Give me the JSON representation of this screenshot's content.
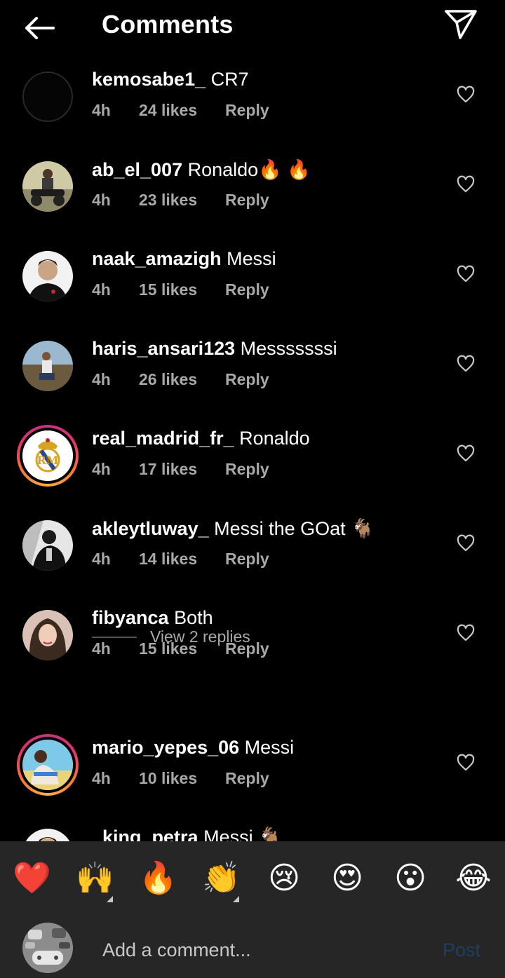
{
  "header": {
    "title": "Comments",
    "back_icon": "arrow-left-icon",
    "send_icon": "paper-plane-icon"
  },
  "comments": [
    {
      "user": "kemosabe1_",
      "text": "CR7",
      "time": "4h",
      "likes": "24 likes",
      "reply": "Reply",
      "avatar_style": "plain",
      "story_ring": false
    },
    {
      "user": "ab_el_007",
      "text": "Ronaldo🔥 🔥",
      "time": "4h",
      "likes": "23 likes",
      "reply": "Reply",
      "avatar_style": "motorbike",
      "story_ring": false
    },
    {
      "user": "naak_amazigh",
      "text": "Messi",
      "time": "4h",
      "likes": "15 likes",
      "reply": "Reply",
      "avatar_style": "portrait",
      "story_ring": false
    },
    {
      "user": "haris_ansari123",
      "text": "Messsssssi",
      "time": "4h",
      "likes": "26 likes",
      "reply": "Reply",
      "avatar_style": "outdoor",
      "story_ring": false
    },
    {
      "user": "real_madrid_fr_",
      "text": "Ronaldo",
      "time": "4h",
      "likes": "17 likes",
      "reply": "Reply",
      "avatar_style": "crest",
      "story_ring": true
    },
    {
      "user": "akleytluway_",
      "text": "Messi the GOat 🐐",
      "time": "4h",
      "likes": "14 likes",
      "reply": "Reply",
      "avatar_style": "bw",
      "story_ring": false
    },
    {
      "user": "fibyanca",
      "text": "Both",
      "time": "4h",
      "likes": "15 likes",
      "reply": "Reply",
      "avatar_style": "woman",
      "story_ring": false
    },
    {
      "user": "mario_yepes_06",
      "text": "Messi",
      "time": "4h",
      "likes": "10 likes",
      "reply": "Reply",
      "avatar_style": "beach",
      "story_ring": true
    },
    {
      "user": "_king_petra",
      "text": "Messi 🐐",
      "time": "",
      "likes": "",
      "reply": "",
      "avatar_style": "portrait",
      "story_ring": false
    }
  ],
  "view_replies": "View 2 replies",
  "reactions": [
    {
      "emoji": "❤️",
      "name": "red-heart-emoji",
      "has_variants": false
    },
    {
      "emoji": "🙌",
      "name": "raising-hands-emoji",
      "has_variants": true
    },
    {
      "emoji": "🔥",
      "name": "fire-emoji",
      "has_variants": false
    },
    {
      "emoji": "👏",
      "name": "clapping-hands-emoji",
      "has_variants": true
    },
    {
      "emoji": "😢",
      "name": "crying-face-emoji",
      "has_variants": false
    },
    {
      "emoji": "😍",
      "name": "heart-eyes-emoji",
      "has_variants": false
    },
    {
      "emoji": "😮",
      "name": "surprised-face-emoji",
      "has_variants": false
    },
    {
      "emoji": "😂",
      "name": "tears-of-joy-emoji",
      "has_variants": false
    }
  ],
  "composer": {
    "placeholder": "Add a comment...",
    "post_label": "Post"
  },
  "colors": {
    "background": "#000000",
    "secondary_text": "#a8a8a8",
    "bottom_bar": "#262626",
    "post_disabled": "#1d3f66"
  }
}
